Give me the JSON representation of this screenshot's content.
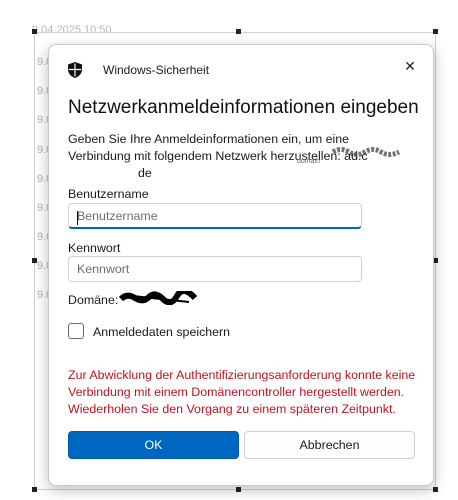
{
  "background": {
    "top_text": "9.04.2025 10:50",
    "row_label": "9.0",
    "row_count": 9
  },
  "dialog": {
    "app_title": "Windows-Sicherheit",
    "close_glyph": "✕",
    "heading": "Netzwerkanmeldeinformationen eingeben",
    "description": "Geben Sie Ihre Anmeldeinformationen ein, um eine Verbindung mit folgendem Netzwerk herzustellen: ad.c",
    "description_suffix": "de",
    "domain_hint": "domain",
    "username_label": "Benutzername",
    "username_placeholder": "Benutzername",
    "password_label": "Kennwort",
    "password_placeholder": "Kennwort",
    "domain_label": "Domäne:",
    "remember_label": "Anmeldedaten speichern",
    "remember_checked": false,
    "error_message": "Zur Abwicklung der Authentifizierungsanforderung konnte keine Verbindung mit einem Domänencontroller hergestellt werden. Wiederholen Sie den Vorgang zu einem späteren Zeitpunkt.",
    "ok_label": "OK",
    "cancel_label": "Abbrechen"
  },
  "colors": {
    "accent": "#0067c0",
    "error": "#c50f1f",
    "text": "#1a1a1a"
  },
  "icons": {
    "app": "shield-icon",
    "close": "close-icon"
  }
}
